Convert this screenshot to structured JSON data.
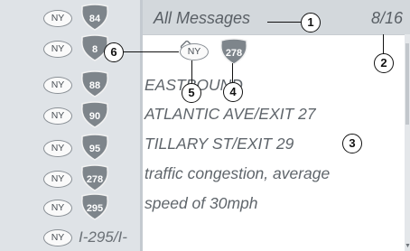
{
  "header": {
    "title": "All Messages",
    "page": "8/16"
  },
  "left_list": [
    {
      "badge": "NY",
      "route": "84"
    },
    {
      "badge": "NY",
      "route": "8"
    },
    {
      "badge": "NY",
      "route": "88"
    },
    {
      "badge": "NY",
      "route": "90"
    },
    {
      "badge": "NY",
      "route": "95"
    },
    {
      "badge": "NY",
      "route": "278"
    },
    {
      "badge": "NY",
      "route": "295"
    },
    {
      "badge": "NY",
      "route_text": "I-295/I-"
    }
  ],
  "message": {
    "state_badge": "NY",
    "shield": "278",
    "lines": [
      "EASTBOUND",
      "ATLANTIC AVE/EXIT 27",
      "TILLARY ST/EXIT 29",
      "traffic congestion, average",
      "speed of 30mph"
    ]
  },
  "callouts": [
    "1",
    "2",
    "3",
    "4",
    "5",
    "6"
  ],
  "colors": {
    "sidebar": "#dfe3e7",
    "header": "#d3d8dc",
    "shield": "#7e858b",
    "text": "#5f656b"
  }
}
